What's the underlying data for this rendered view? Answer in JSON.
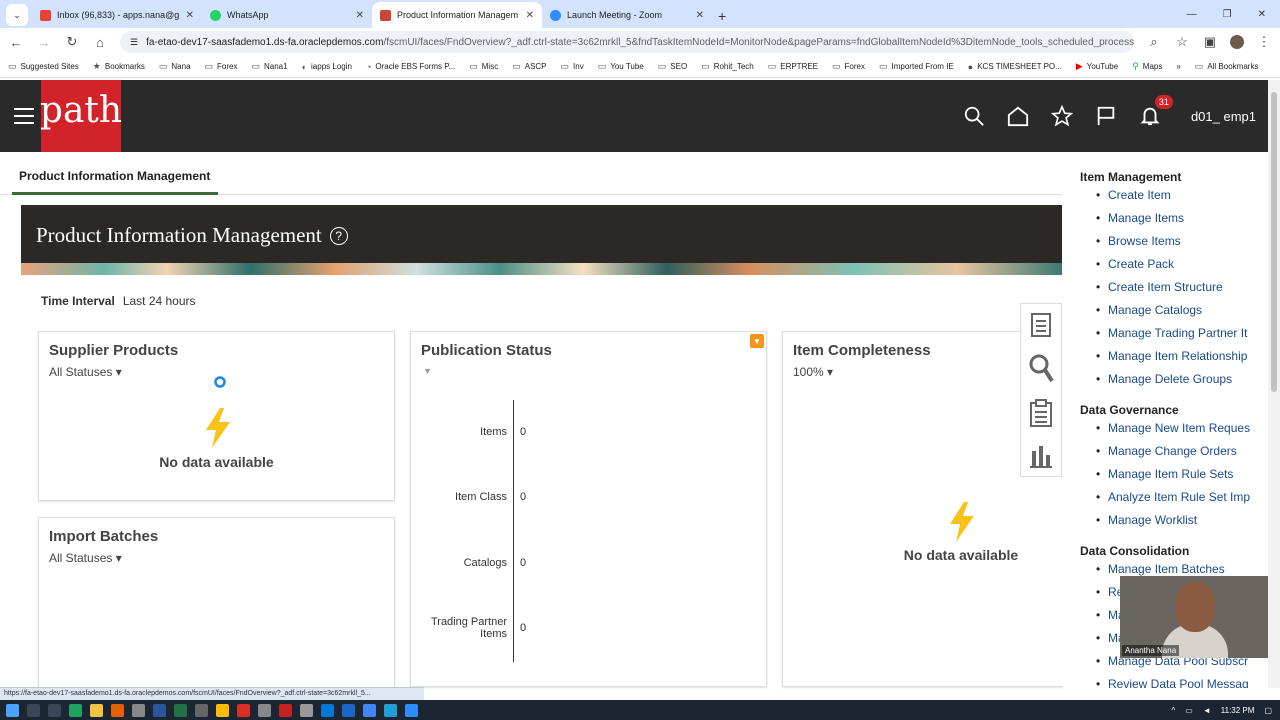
{
  "browser": {
    "tabs": [
      {
        "title": "Inbox (96,833) - apps.nana@g",
        "color": "#ea4335",
        "active": false
      },
      {
        "title": "WhatsApp",
        "color": "#25d366",
        "active": false
      },
      {
        "title": "Product Information Managem",
        "color": "#c74634",
        "active": true
      },
      {
        "title": "Launch Meeting - Zoom",
        "color": "#2d8cff",
        "active": false
      }
    ],
    "url_host": "fa-etao-dev17-saasfademo1.ds-fa.oraclepdemos.com",
    "url_path": "/fscmUI/faces/FndOverview?_adf.ctrl-state=3c62mrkll_5&fndTaskItemNodeId=MonitorNode&pageParams=fndGlobalItemNodeId%3DitemNode_tools_scheduled_processes_fuse_plus%3BfndT...",
    "bookmarks": [
      "Suggested Sites",
      "Bookmarks",
      "Nana",
      "Forex",
      "Nana1",
      "iapps Login",
      "Oracle EBS Forms P...",
      "Misc",
      "ASCP",
      "Inv",
      "You Tube",
      "SEO",
      "Rohit_Tech",
      "ERPTREE",
      "Forex",
      "Imported From IE",
      "KCS TIMESHEET PO...",
      "YouTube",
      "Maps"
    ],
    "all_bookmarks": "All Bookmarks",
    "status_url": "https://fa-etao-dev17-saasfademo1.ds-fa.oraclepdemos.com/fscmUI/faces/FndOverview?_adf.ctrl-state=3c62mrkll_5..."
  },
  "header": {
    "logo": "path",
    "notification_count": "31",
    "user": "d01_ emp1"
  },
  "page": {
    "tab": "Product Information Management",
    "banner_title": "Product Information Management",
    "help": "?",
    "interval_label": "Time Interval",
    "interval_value": "Last 24 hours"
  },
  "cards": {
    "supplier": {
      "title": "Supplier Products",
      "filter": "All Statuses",
      "empty": "No data available"
    },
    "import": {
      "title": "Import Batches",
      "filter": "All Statuses"
    },
    "publication": {
      "title": "Publication Status",
      "rows": [
        {
          "label": "Items",
          "value": "0"
        },
        {
          "label": "Item Class",
          "value": "0"
        },
        {
          "label": "Catalogs",
          "value": "0"
        },
        {
          "label": "Trading Partner Items",
          "value": "0"
        }
      ]
    },
    "completeness": {
      "title": "Item Completeness",
      "filter": "100%",
      "empty": "No data available"
    }
  },
  "panel": {
    "sections": [
      {
        "title": "Item Management",
        "links": [
          "Create Item",
          "Manage Items",
          "Browse Items",
          "Create Pack",
          "Create Item Structure",
          "Manage Catalogs",
          "Manage Trading Partner It",
          "Manage Item Relationship",
          "Manage Delete Groups"
        ]
      },
      {
        "title": "Data Governance",
        "links": [
          "Manage New Item Reques",
          "Manage Change Orders",
          "Manage Item Rule Sets",
          "Analyze Item Rule Set Imp",
          "Manage Worklist"
        ]
      },
      {
        "title": "Data Consolidation",
        "links": [
          "Manage Item Batches",
          "Re",
          "Ma",
          "Ma",
          "Manage Data Pool Subscr",
          "Review Data Pool Messag"
        ]
      }
    ]
  },
  "video": {
    "name": "Anantha Nana"
  },
  "taskbar": {
    "time": "11:32 PM"
  }
}
